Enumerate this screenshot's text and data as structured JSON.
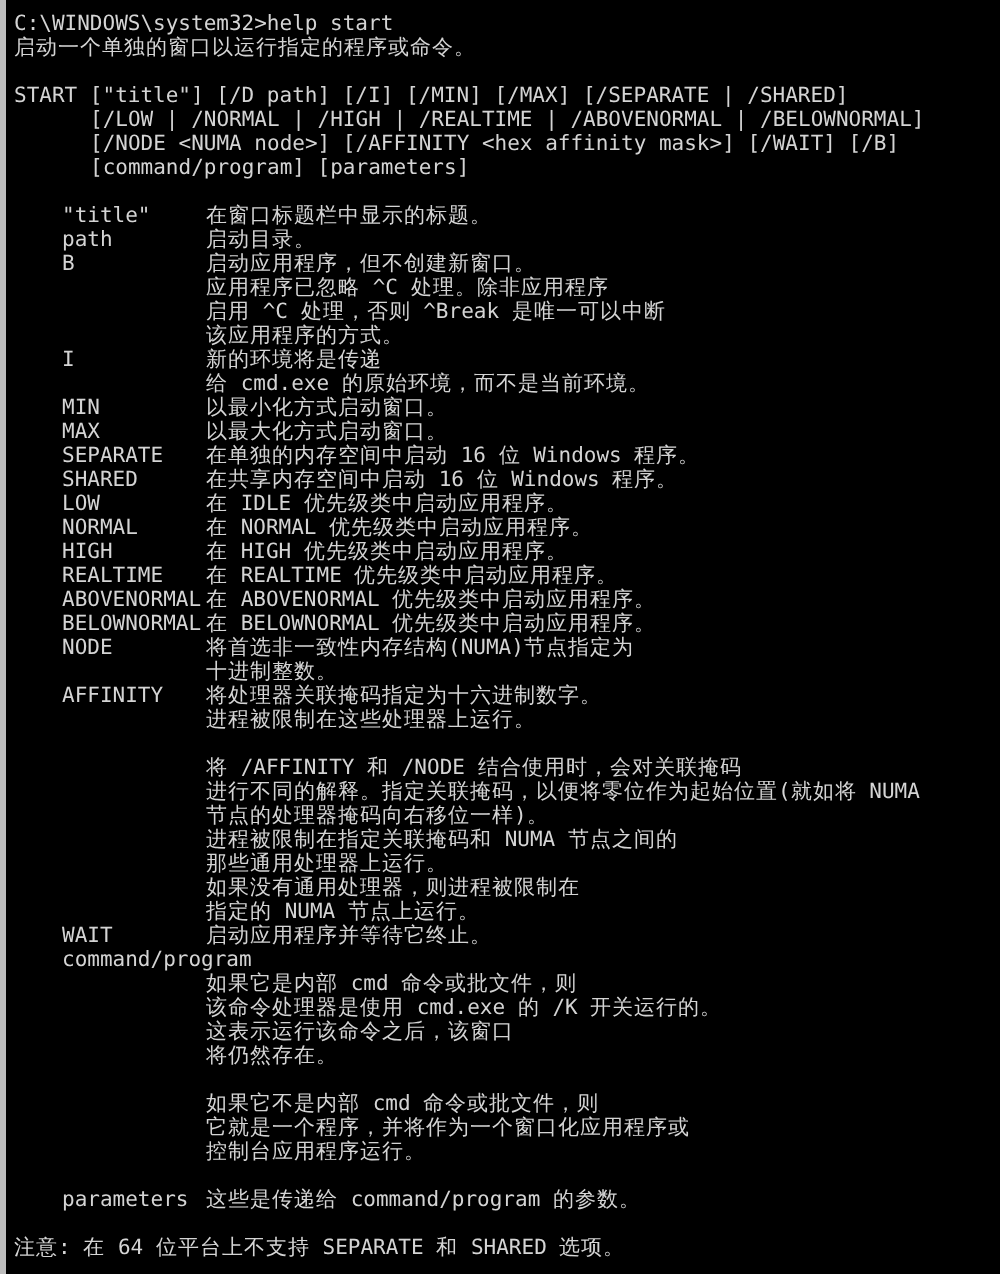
{
  "console": {
    "lines": [
      {
        "kind": "plain",
        "text": "C:\\WINDOWS\\system32>help start"
      },
      {
        "kind": "plain",
        "text": "启动一个单独的窗口以运行指定的程序或命令。"
      },
      {
        "kind": "blank"
      },
      {
        "kind": "plain",
        "text": "START [\"title\"] [/D path] [/I] [/MIN] [/MAX] [/SEPARATE | /SHARED]"
      },
      {
        "kind": "usage",
        "text": "[/LOW | /NORMAL | /HIGH | /REALTIME | /ABOVENORMAL | /BELOWNORMAL]"
      },
      {
        "kind": "usage",
        "text": "[/NODE <NUMA node>] [/AFFINITY <hex affinity mask>] [/WAIT] [/B]"
      },
      {
        "kind": "usage",
        "text": "[command/program] [parameters]"
      },
      {
        "kind": "blank"
      },
      {
        "kind": "option",
        "name": "\"title\"",
        "text": "在窗口标题栏中显示的标题。"
      },
      {
        "kind": "option",
        "name": "path",
        "text": "启动目录。"
      },
      {
        "kind": "option",
        "name": "B",
        "text": "启动应用程序，但不创建新窗口。"
      },
      {
        "kind": "desc",
        "text": "应用程序已忽略 ^C 处理。除非应用程序"
      },
      {
        "kind": "desc",
        "text": "启用 ^C 处理，否则 ^Break 是唯一可以中断"
      },
      {
        "kind": "desc",
        "text": "该应用程序的方式。"
      },
      {
        "kind": "option",
        "name": "I",
        "text": "新的环境将是传递"
      },
      {
        "kind": "desc",
        "text": "给 cmd.exe 的原始环境，而不是当前环境。"
      },
      {
        "kind": "option",
        "name": "MIN",
        "text": "以最小化方式启动窗口。"
      },
      {
        "kind": "option",
        "name": "MAX",
        "text": "以最大化方式启动窗口。"
      },
      {
        "kind": "option",
        "name": "SEPARATE",
        "text": "在单独的内存空间中启动 16 位 Windows 程序。"
      },
      {
        "kind": "option",
        "name": "SHARED",
        "text": "在共享内存空间中启动 16 位 Windows 程序。"
      },
      {
        "kind": "option",
        "name": "LOW",
        "text": "在 IDLE 优先级类中启动应用程序。"
      },
      {
        "kind": "option",
        "name": "NORMAL",
        "text": "在 NORMAL 优先级类中启动应用程序。"
      },
      {
        "kind": "option",
        "name": "HIGH",
        "text": "在 HIGH 优先级类中启动应用程序。"
      },
      {
        "kind": "option",
        "name": "REALTIME",
        "text": "在 REALTIME 优先级类中启动应用程序。"
      },
      {
        "kind": "option",
        "name": "ABOVENORMAL",
        "text": "在 ABOVENORMAL 优先级类中启动应用程序。"
      },
      {
        "kind": "option",
        "name": "BELOWNORMAL",
        "text": "在 BELOWNORMAL 优先级类中启动应用程序。"
      },
      {
        "kind": "option",
        "name": "NODE",
        "text": "将首选非一致性内存结构(NUMA)节点指定为"
      },
      {
        "kind": "desc",
        "text": "十进制整数。"
      },
      {
        "kind": "option",
        "name": "AFFINITY",
        "text": "将处理器关联掩码指定为十六进制数字。"
      },
      {
        "kind": "desc",
        "text": "进程被限制在这些处理器上运行。"
      },
      {
        "kind": "blank"
      },
      {
        "kind": "desc",
        "text": "将 /AFFINITY 和 /NODE 结合使用时，会对关联掩码"
      },
      {
        "kind": "desc",
        "text": "进行不同的解释。指定关联掩码，以便将零位作为起始位置(就如将 NUMA"
      },
      {
        "kind": "desc",
        "text": "节点的处理器掩码向右移位一样)。"
      },
      {
        "kind": "desc",
        "text": "进程被限制在指定关联掩码和 NUMA 节点之间的"
      },
      {
        "kind": "desc",
        "text": "那些通用处理器上运行。"
      },
      {
        "kind": "desc",
        "text": "如果没有通用处理器，则进程被限制在"
      },
      {
        "kind": "desc",
        "text": "指定的 NUMA 节点上运行。"
      },
      {
        "kind": "option",
        "name": "WAIT",
        "text": "启动应用程序并等待它终止。"
      },
      {
        "kind": "name",
        "name": "command/program"
      },
      {
        "kind": "desc",
        "text": "如果它是内部 cmd 命令或批文件，则"
      },
      {
        "kind": "desc",
        "text": "该命令处理器是使用 cmd.exe 的 /K 开关运行的。"
      },
      {
        "kind": "desc",
        "text": "这表示运行该命令之后，该窗口"
      },
      {
        "kind": "desc",
        "text": "将仍然存在。"
      },
      {
        "kind": "blank"
      },
      {
        "kind": "desc",
        "text": "如果它不是内部 cmd 命令或批文件，则"
      },
      {
        "kind": "desc",
        "text": "它就是一个程序，并将作为一个窗口化应用程序或"
      },
      {
        "kind": "desc",
        "text": "控制台应用程序运行。"
      },
      {
        "kind": "blank"
      },
      {
        "kind": "option",
        "name": "parameters",
        "text": "这些是传递给 command/program 的参数。"
      },
      {
        "kind": "blank"
      },
      {
        "kind": "plain",
        "text": "注意: 在 64 位平台上不支持 SEPARATE 和 SHARED 选项。"
      }
    ]
  }
}
